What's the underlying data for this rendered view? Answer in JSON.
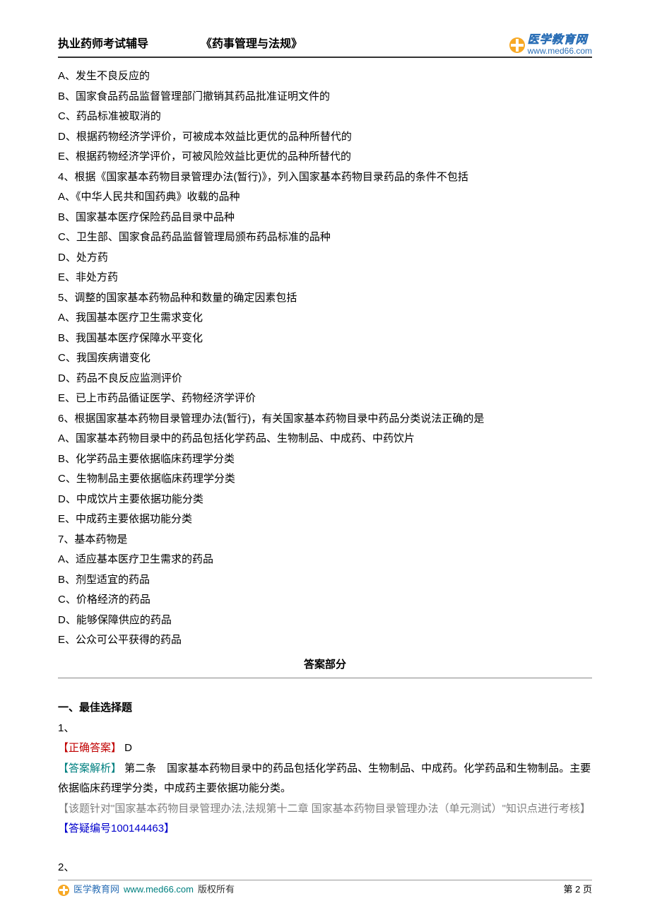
{
  "header": {
    "left1": "执业药师考试辅导",
    "left2": "《药事管理与法规》",
    "logo_cn": "医学教育网",
    "logo_url": "www.med66.com"
  },
  "questions": [
    "A、发生不良反应的",
    "B、国家食品药品监督管理部门撤销其药品批准证明文件的",
    "C、药品标准被取消的",
    "D、根据药物经济学评价，可被成本效益比更优的品种所替代的",
    "E、根据药物经济学评价，可被风险效益比更优的品种所替代的",
    "4、根据《国家基本药物目录管理办法(暂行)》，列入国家基本药物目录药品的条件不包括",
    "A、《中华人民共和国药典》收载的品种",
    "B、国家基本医疗保险药品目录中品种",
    "C、卫生部、国家食品药品监督管理局颁布药品标准的品种",
    "D、处方药",
    "E、非处方药",
    "5、调整的国家基本药物品种和数量的确定因素包括",
    "A、我国基本医疗卫生需求变化",
    "B、我国基本医疗保障水平变化",
    "C、我国疾病谱变化",
    "D、药品不良反应监测评价",
    "E、已上市药品循证医学、药物经济学评价",
    "6、根据国家基本药物目录管理办法(暂行)，有关国家基本药物目录中药品分类说法正确的是",
    "A、国家基本药物目录中的药品包括化学药品、生物制品、中成药、中药饮片",
    "B、化学药品主要依据临床药理学分类",
    "C、生物制品主要依据临床药理学分类",
    "D、中成饮片主要依据功能分类",
    "E、中成药主要依据功能分类",
    "7、基本药物是",
    "A、适应基本医疗卫生需求的药品",
    "B、剂型适宜的药品",
    "C、价格经济的药品",
    "D、能够保障供应的药品",
    "E、公众可公平获得的药品"
  ],
  "answers_section_title": "答案部分",
  "answers": {
    "section_type": "一、最佳选择题",
    "q1": {
      "num": "1、",
      "correct_label": "【正确答案】",
      "correct_value": " D",
      "explain_label": "【答案解析】",
      "explain_text": " 第二条　国家基本药物目录中的药品包括化学药品、生物制品、中成药。化学药品和生物制品。主要依据临床药理学分类，中成药主要依据功能分类。",
      "topic_label_open": "【该题针对\"",
      "topic_text": "国家基本药物目录管理办法,法规第十二章 国家基本药物目录管理办法（单元测试）",
      "topic_label_close": "\"知识点进行考核】",
      "ref_label": "【答疑编号",
      "ref_num": "100144463",
      "ref_close": "】"
    },
    "q2_num": "2、"
  },
  "footer": {
    "site": "医学教育网",
    "url": "www.med66.com",
    "copy": "版权所有",
    "page": "第 2 页"
  }
}
